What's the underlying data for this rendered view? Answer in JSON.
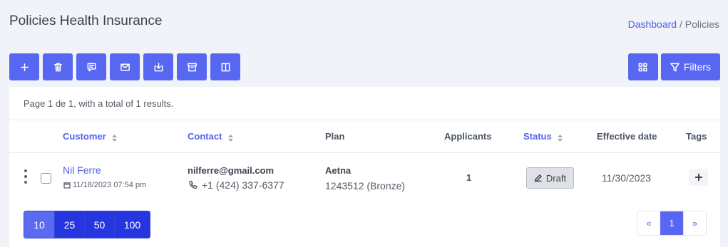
{
  "header": {
    "title": "Policies Health Insurance",
    "breadcrumb": {
      "parent": "Dashboard",
      "separator": "/",
      "current": "Policies"
    }
  },
  "toolbar": {
    "actions": [
      "add-icon",
      "trash-icon",
      "comment-icon",
      "mail-icon",
      "download-icon",
      "archive-icon",
      "columns-icon"
    ],
    "grid_icon": "grid-icon",
    "filters_label": "Filters"
  },
  "summary": "Page 1 de 1, with a total of 1 results.",
  "table": {
    "headers": {
      "customer": "Customer",
      "contact": "Contact",
      "plan": "Plan",
      "applicants": "Applicants",
      "status": "Status",
      "effective_date": "Effective date",
      "tags": "Tags"
    },
    "rows": [
      {
        "customer_name": "Nil Ferre",
        "created": "11/18/2023 07:54 pm",
        "email": "nilferre@gmail.com",
        "phone": "+1 (424) 337-6377",
        "plan_name": "Aetna",
        "plan_detail": "1243512 (Bronze)",
        "applicants": "1",
        "status": "Draft",
        "effective_date": "11/30/2023"
      }
    ]
  },
  "pagination": {
    "page_sizes": [
      "10",
      "25",
      "50",
      "100"
    ],
    "selected_page_size": "10",
    "prev": "«",
    "current_page": "1",
    "next": "»"
  },
  "colors": {
    "primary": "#5867f1",
    "page_size_active": "#5b6bf0",
    "page_size": "#2536e0",
    "link": "#4f60e6",
    "background": "#f1f3f8"
  }
}
